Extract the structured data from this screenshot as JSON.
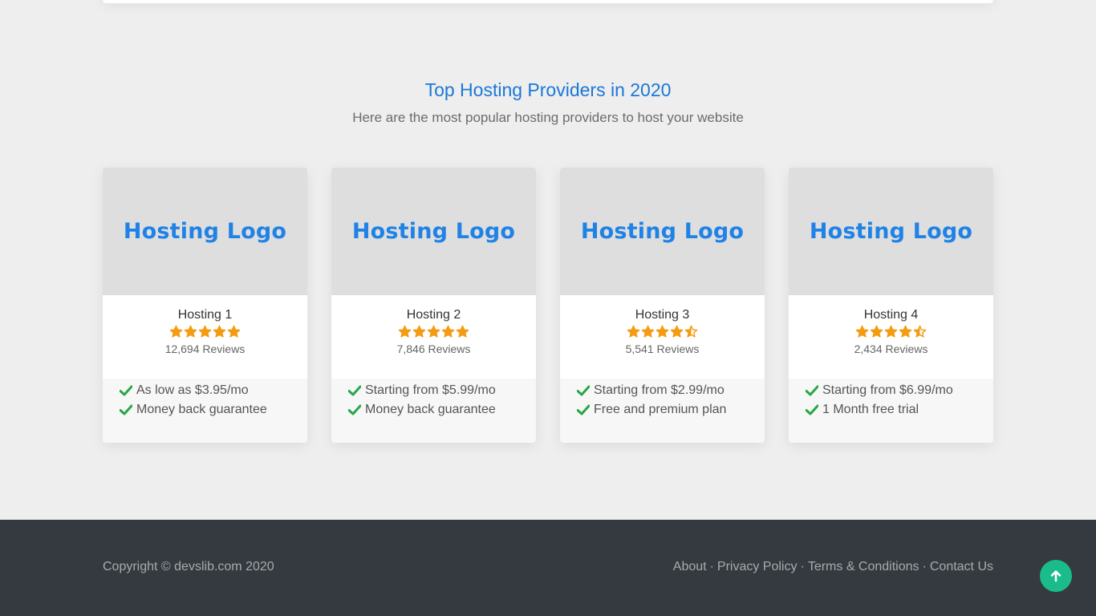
{
  "section": {
    "title": "Top Hosting Providers in 2020",
    "subtitle": "Here are the most popular hosting providers to host your website"
  },
  "providers": [
    {
      "logo_text": "Hosting Logo",
      "name": "Hosting 1",
      "rating": 5,
      "reviews": "12,694 Reviews",
      "features": [
        "As low as $3.95/mo",
        "Money back guarantee"
      ]
    },
    {
      "logo_text": "Hosting Logo",
      "name": "Hosting 2",
      "rating": 5,
      "reviews": "7,846 Reviews",
      "features": [
        "Starting from $5.99/mo",
        "Money back guarantee"
      ]
    },
    {
      "logo_text": "Hosting Logo",
      "name": "Hosting 3",
      "rating": 4.5,
      "reviews": "5,541 Reviews",
      "features": [
        "Starting from $2.99/mo",
        "Free and premium plan"
      ]
    },
    {
      "logo_text": "Hosting Logo",
      "name": "Hosting 4",
      "rating": 4.5,
      "reviews": "2,434 Reviews",
      "features": [
        "Starting from $6.99/mo",
        "1 Month free trial"
      ]
    }
  ],
  "footer": {
    "copyright": "Copyright © devslib.com 2020",
    "links": [
      "About",
      "Privacy Policy",
      "Terms & Conditions",
      "Contact Us"
    ],
    "separator": "·"
  },
  "scroll_top": {
    "icon": "arrow-up-icon"
  },
  "colors": {
    "accent": "#1a78d8",
    "star": "#f39c12",
    "check": "#28a745",
    "footer_bg": "#343a40",
    "scroll_button": "#1abc8c"
  }
}
